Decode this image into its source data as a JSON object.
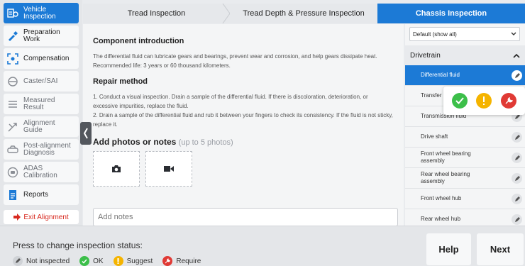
{
  "sidebar": {
    "items": [
      {
        "label": "Vehicle\nInspection",
        "icon": "vehicle-inspection-icon"
      },
      {
        "label": "Preparation\nWork",
        "icon": "preparation-icon"
      },
      {
        "label": "Compensation",
        "icon": "compensation-icon"
      },
      {
        "label": "Caster/SAI",
        "icon": "caster-icon"
      },
      {
        "label": "Measured\nResult",
        "icon": "measured-result-icon"
      },
      {
        "label": "Alignment\nGuide",
        "icon": "alignment-guide-icon"
      },
      {
        "label": "Post-alignment\nDiagnosis",
        "icon": "post-alignment-icon"
      },
      {
        "label": "ADAS\nCalibration",
        "icon": "adas-icon"
      },
      {
        "label": "Reports",
        "icon": "reports-icon"
      }
    ],
    "exit_label": "Exit Alignment"
  },
  "tabs": [
    "Tread Inspection",
    "Tread Depth & Pressure Inspection",
    "Chassis Inspection"
  ],
  "content": {
    "intro_title": "Component introduction",
    "intro_text": "The differential fluid can lubricate gears and bearings, prevent wear and corrosion, and help gears dissipate heat.",
    "life_text": "Recommended life: 3 years or 60 thousand kilometers.",
    "repair_title": "Repair method",
    "repair_step1": "1. Conduct a visual inspection. Drain a sample of the differential fluid. If there is discoloration, deterioration, or excessive impurities, replace the fluid.",
    "repair_step2": "2. Drain a sample of the differential fluid and rub it between your fingers to check its consistency. If the fluid is not sticky, replace it.",
    "photos_title": "Add photos or notes",
    "photos_hint": "(up to 5 photos)",
    "notes_placeholder": "Add notes"
  },
  "right_panel": {
    "filter_value": "Default (show all)",
    "section": "Drivetrain",
    "items": [
      "Differential fluid",
      "Transfer",
      "Transmission fluid",
      "Drive shaft",
      "Front wheel bearing\nassembly",
      "Rear wheel bearing\nassembly",
      "Front wheel hub",
      "Rear wheel hub"
    ],
    "selected_index": 0
  },
  "status_colors": {
    "ok": "#3cbf4a",
    "suggest": "#f5b400",
    "require": "#e03a35",
    "accent": "#1c7ad6"
  },
  "bottom": {
    "press_text": "Press to change inspection status:",
    "legend": [
      "Not inspected",
      "OK",
      "Suggest",
      "Require"
    ],
    "help_label": "Help",
    "next_label": "Next"
  }
}
